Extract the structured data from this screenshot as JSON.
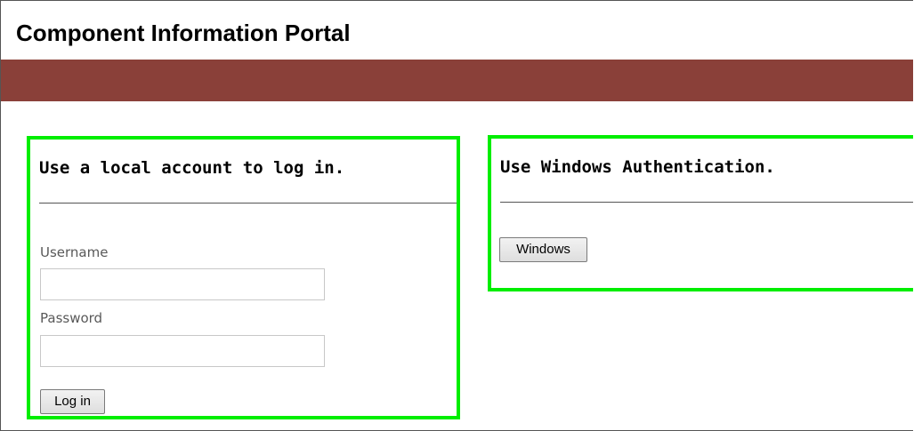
{
  "header": {
    "title": "Component Information Portal",
    "brand_color": "#8a4039"
  },
  "accent_color": "#00ee00",
  "local_login": {
    "heading": "Use a local account to log in.",
    "username_label": "Username",
    "username_value": "",
    "password_label": "Password",
    "password_value": "",
    "submit_label": "Log in"
  },
  "windows_login": {
    "heading": "Use Windows Authentication.",
    "button_label": "Windows"
  }
}
